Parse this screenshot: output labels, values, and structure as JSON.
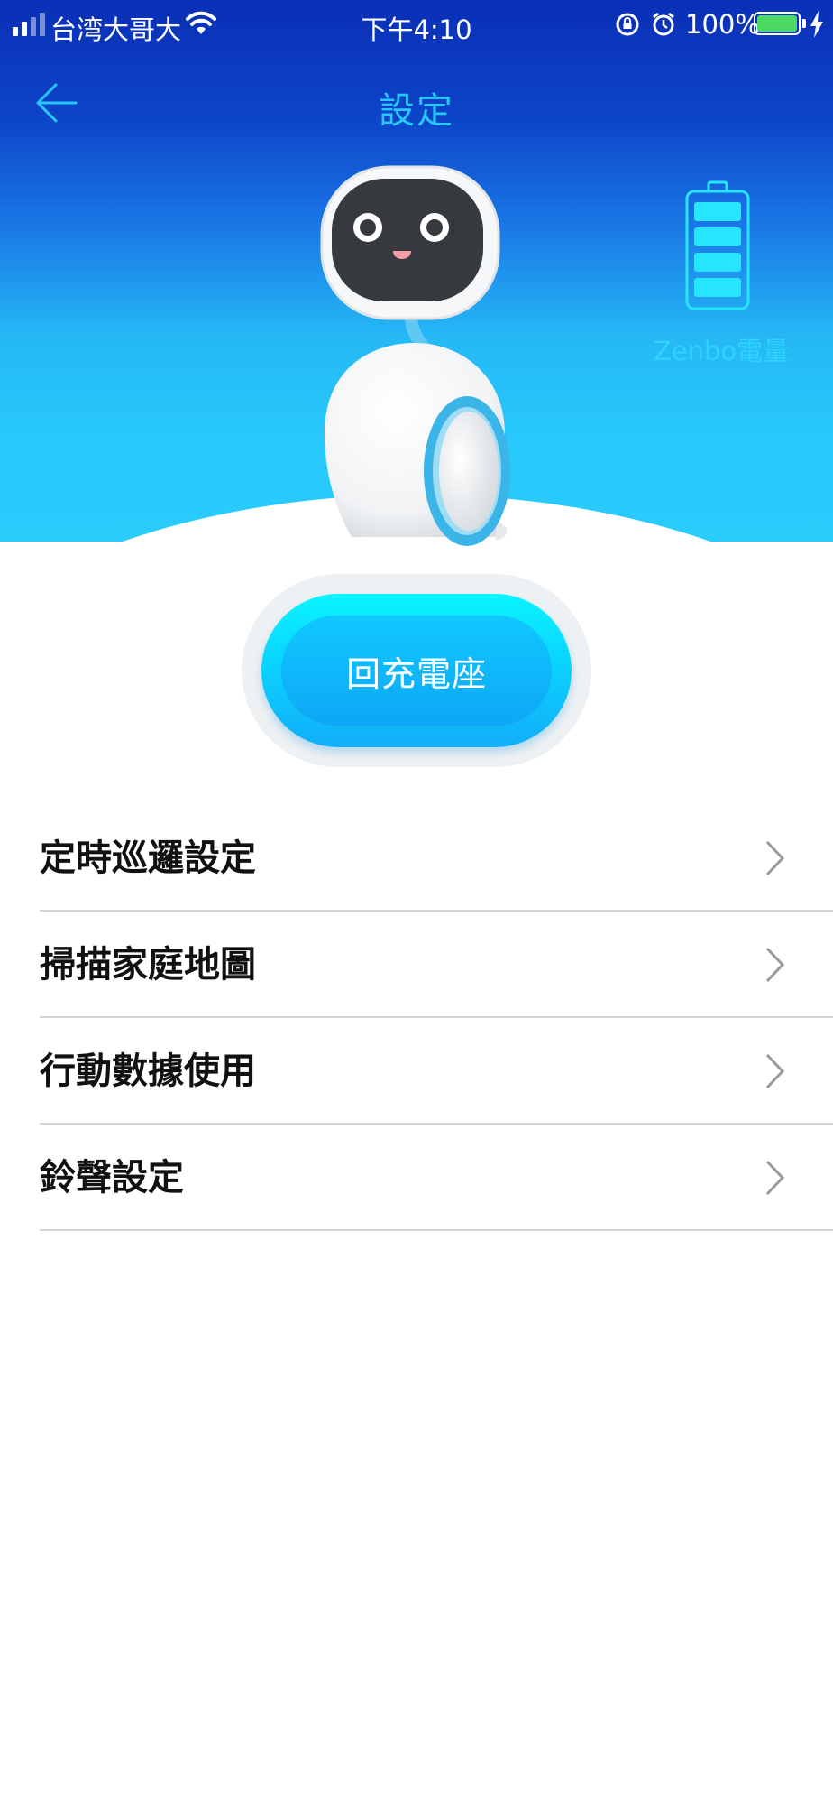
{
  "status_bar": {
    "carrier": "台湾大哥大",
    "time": "下午4:10",
    "battery_percent": "100%",
    "battery_level": 1.0,
    "battery_color": "#4cd964",
    "icons": [
      "signal-icon",
      "wifi-icon",
      "rotation-lock-icon",
      "alarm-icon",
      "battery-icon",
      "charging-bolt-icon"
    ]
  },
  "header": {
    "title": "設定",
    "back_icon": "back-arrow-icon"
  },
  "robot": {
    "battery_label": "Zenbo電量",
    "battery_bars": 4
  },
  "charge_button": {
    "label": "回充電座"
  },
  "menu": {
    "items": [
      {
        "label": "定時巡邏設定"
      },
      {
        "label": "掃描家庭地圖"
      },
      {
        "label": "行動數據使用"
      },
      {
        "label": "鈴聲設定"
      }
    ]
  },
  "colors": {
    "accent": "#29c6ff",
    "header_gradient_top": "#0a2fb6",
    "header_gradient_bottom": "#29ccfb",
    "button": "#0ad3ff"
  }
}
